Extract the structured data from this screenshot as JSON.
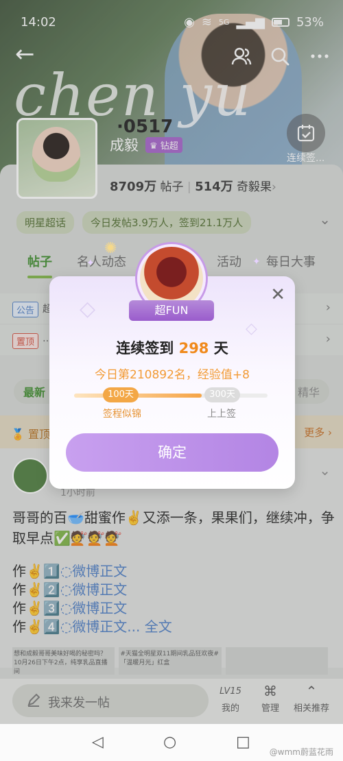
{
  "status_bar": {
    "time": "14:02",
    "battery": "53%",
    "signal": "5G"
  },
  "hero": {
    "script_text": "chen yu",
    "code": "0517"
  },
  "profile": {
    "name": "成毅",
    "rank_badge": "钻超",
    "signin_label": "连续签..."
  },
  "stats": {
    "posts_count": "8709万",
    "posts_label": "帖子",
    "fans_count": "514万",
    "fans_label": "奇毅果"
  },
  "chips": [
    "明星超话",
    "今日发帖3.9万人，签到21.1万人"
  ],
  "tabs": [
    {
      "label": "帖子",
      "active": true
    },
    {
      "label": "名人动态",
      "active": false
    },
    {
      "label": "活动",
      "active": false
    },
    {
      "label": "每日大事",
      "active": false
    }
  ],
  "notices": [
    {
      "tag": "公告",
      "tag_color": "#4a7bc4",
      "text": "超话…"
    },
    {
      "tag": "置顶",
      "tag_color": "#d24c3b",
      "text": "…"
    }
  ],
  "filter": {
    "left": "最新",
    "right": "精华"
  },
  "pinned": {
    "label": "置顶",
    "more": "更多"
  },
  "post": {
    "time": "1小时前",
    "text": "哥哥的百🥣甜蜜作✌️又添一条，果果们，继续冲，争取早点✅💇💇💇",
    "lines": [
      {
        "prefix": "作✌️1️⃣",
        "link": "微博正文"
      },
      {
        "prefix": "作✌️2️⃣",
        "link": "微博正文"
      },
      {
        "prefix": "作✌️3️⃣",
        "link": "微博正文"
      },
      {
        "prefix": "作✌️4️⃣",
        "link": "微博正文...",
        "extra": "全文"
      }
    ],
    "thumbs": [
      "想和成毅哥哥美味好喝的秘密吗？10月26日下午2点，纯享乳品直播间",
      "#天猫全明星双11期间乳品狂欢夜# 「温暖月光」红盒",
      ""
    ]
  },
  "bottom_bar": {
    "compose": "我来发一帖",
    "items": [
      {
        "icon": "lv-icon",
        "glyph": "LV15",
        "label": "我的"
      },
      {
        "icon": "manage-icon",
        "glyph": "⌘",
        "label": "管理"
      },
      {
        "icon": "recommend-icon",
        "glyph": "⌃",
        "label": "相关推荐"
      }
    ]
  },
  "watermark": "@wmm蔚蓝花雨",
  "dialog": {
    "ribbon": "超FUN",
    "title_prefix": "连续签到",
    "title_days": "298",
    "title_suffix": "天",
    "subtitle": "今日第210892名，经验值+8",
    "progress_fraction": 0.66,
    "milestones": [
      {
        "pill": "100天",
        "caption": "签程似锦"
      },
      {
        "pill": "300天",
        "caption": "上上签"
      }
    ],
    "confirm": "确定"
  },
  "colors": {
    "accent": "#7cb342",
    "dialog_button": "#c09aec",
    "highlight": "#f08a1c"
  }
}
